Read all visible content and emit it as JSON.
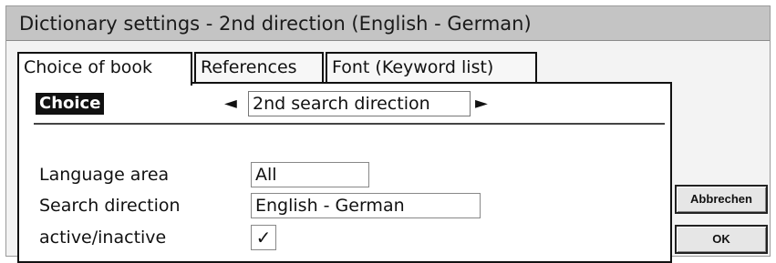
{
  "window": {
    "title": "Dictionary settings - 2nd direction (English - German)"
  },
  "tabs": [
    {
      "label": "Choice of book",
      "active": true
    },
    {
      "label": "References",
      "active": false
    },
    {
      "label": "Font (Keyword list)",
      "active": false
    }
  ],
  "choice": {
    "label": "Choice",
    "left_arrow": "◄",
    "value": "2nd search direction",
    "right_arrow": "►"
  },
  "fields": {
    "language_area": {
      "label": "Language area",
      "value": "All"
    },
    "search_direction": {
      "label": "Search direction",
      "value": "English - German"
    },
    "active": {
      "label": "active/inactive",
      "checked": true,
      "mark": "✓"
    }
  },
  "buttons": {
    "cancel": "Abbrechen",
    "ok": "OK"
  }
}
